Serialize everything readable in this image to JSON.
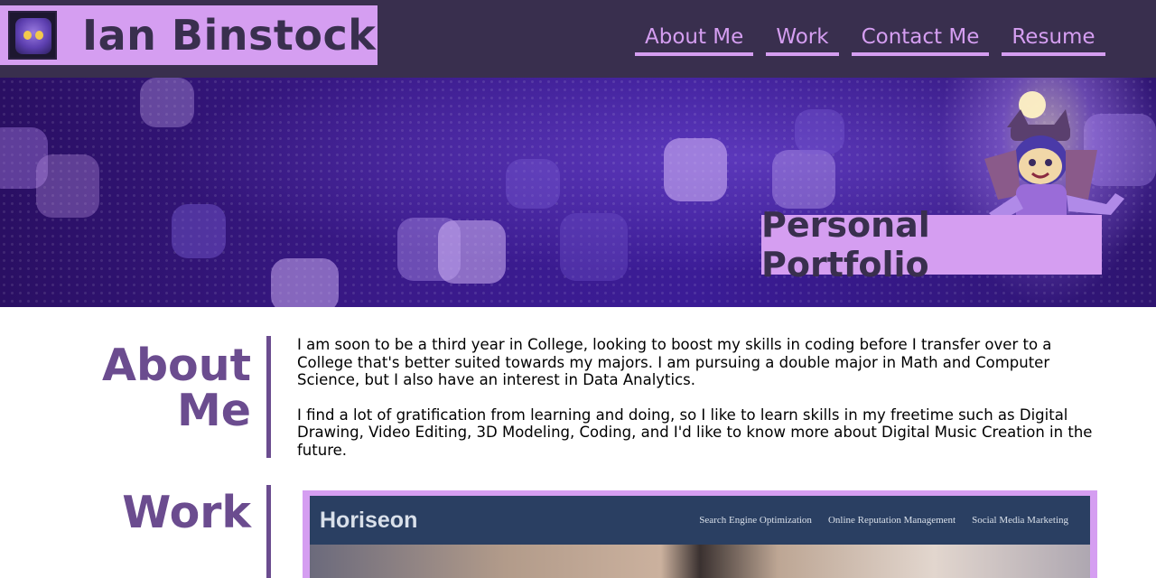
{
  "header": {
    "name": "Ian Binstock",
    "logo_icon": "avatar-cat-icon",
    "nav": [
      {
        "label": "About Me"
      },
      {
        "label": "Work"
      },
      {
        "label": "Contact Me"
      },
      {
        "label": "Resume"
      }
    ]
  },
  "hero": {
    "title": "Personal Portfolio",
    "mascot_icon": "mascot-character-icon"
  },
  "about": {
    "heading_line1": "About",
    "heading_line2": "Me",
    "paragraphs": [
      "I am soon to be a third year in College, looking to boost my skills in coding before I transfer over to a College that's better suited towards my majors. I am pursuing a double major in Math and Computer Science, but I also have an interest in Data Analytics.",
      "I find a lot of gratification from learning and doing, so I like to learn skills in my freetime such as Digital Drawing, Video Editing, 3D Modeling, Coding, and I'd like to know more about Digital Music Creation in the future."
    ]
  },
  "work": {
    "heading": "Work",
    "project": {
      "site_name": "Horiseon",
      "site_nav": [
        "Search Engine Optimization",
        "Online Reputation Management",
        "Social Media Marketing"
      ]
    }
  },
  "colors": {
    "header_bg": "#392f4e",
    "accent": "#d59ef1",
    "heading": "#6b4c8f"
  }
}
